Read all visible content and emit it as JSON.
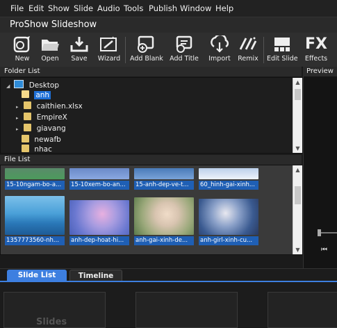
{
  "menu": [
    "File",
    "Edit",
    "Show",
    "Slide",
    "Audio",
    "Tools",
    "Publish",
    "Window",
    "Help"
  ],
  "app_title": "ProShow Slideshow",
  "toolbar": [
    "New",
    "Open",
    "Save",
    "Wizard",
    "Add Blank",
    "Add Title",
    "Import",
    "Remix",
    "Edit Slide",
    "Effects"
  ],
  "toolbar_fx_glyph": "FX",
  "folder_list": {
    "header": "Folder List",
    "root": "Desktop",
    "items": [
      "anh",
      "caithien.xlsx",
      "EmpireX",
      "giavang",
      "newafb",
      "nhac"
    ],
    "selected": "anh"
  },
  "file_list": {
    "header": "File List",
    "row1": [
      "15-10ngam-bo-a...",
      "15-10xem-bo-an...",
      "15-anh-dep-ve-t...",
      "60_hinh-gai-xinh..."
    ],
    "row2": [
      "1357773560-nh...",
      "anh-dep-hoat-hi...",
      "anh-gai-xinh-de...",
      "anh-girl-xinh-cu..."
    ]
  },
  "preview": {
    "header": "Preview"
  },
  "bottom": {
    "tabs": [
      "Slide List",
      "Timeline"
    ],
    "active_tab": "Slide List",
    "placeholder": "Slides"
  },
  "colors": {
    "accent": "#3d7fe0",
    "selection": "#1e6fd6",
    "caption": "#1f5fb4"
  }
}
